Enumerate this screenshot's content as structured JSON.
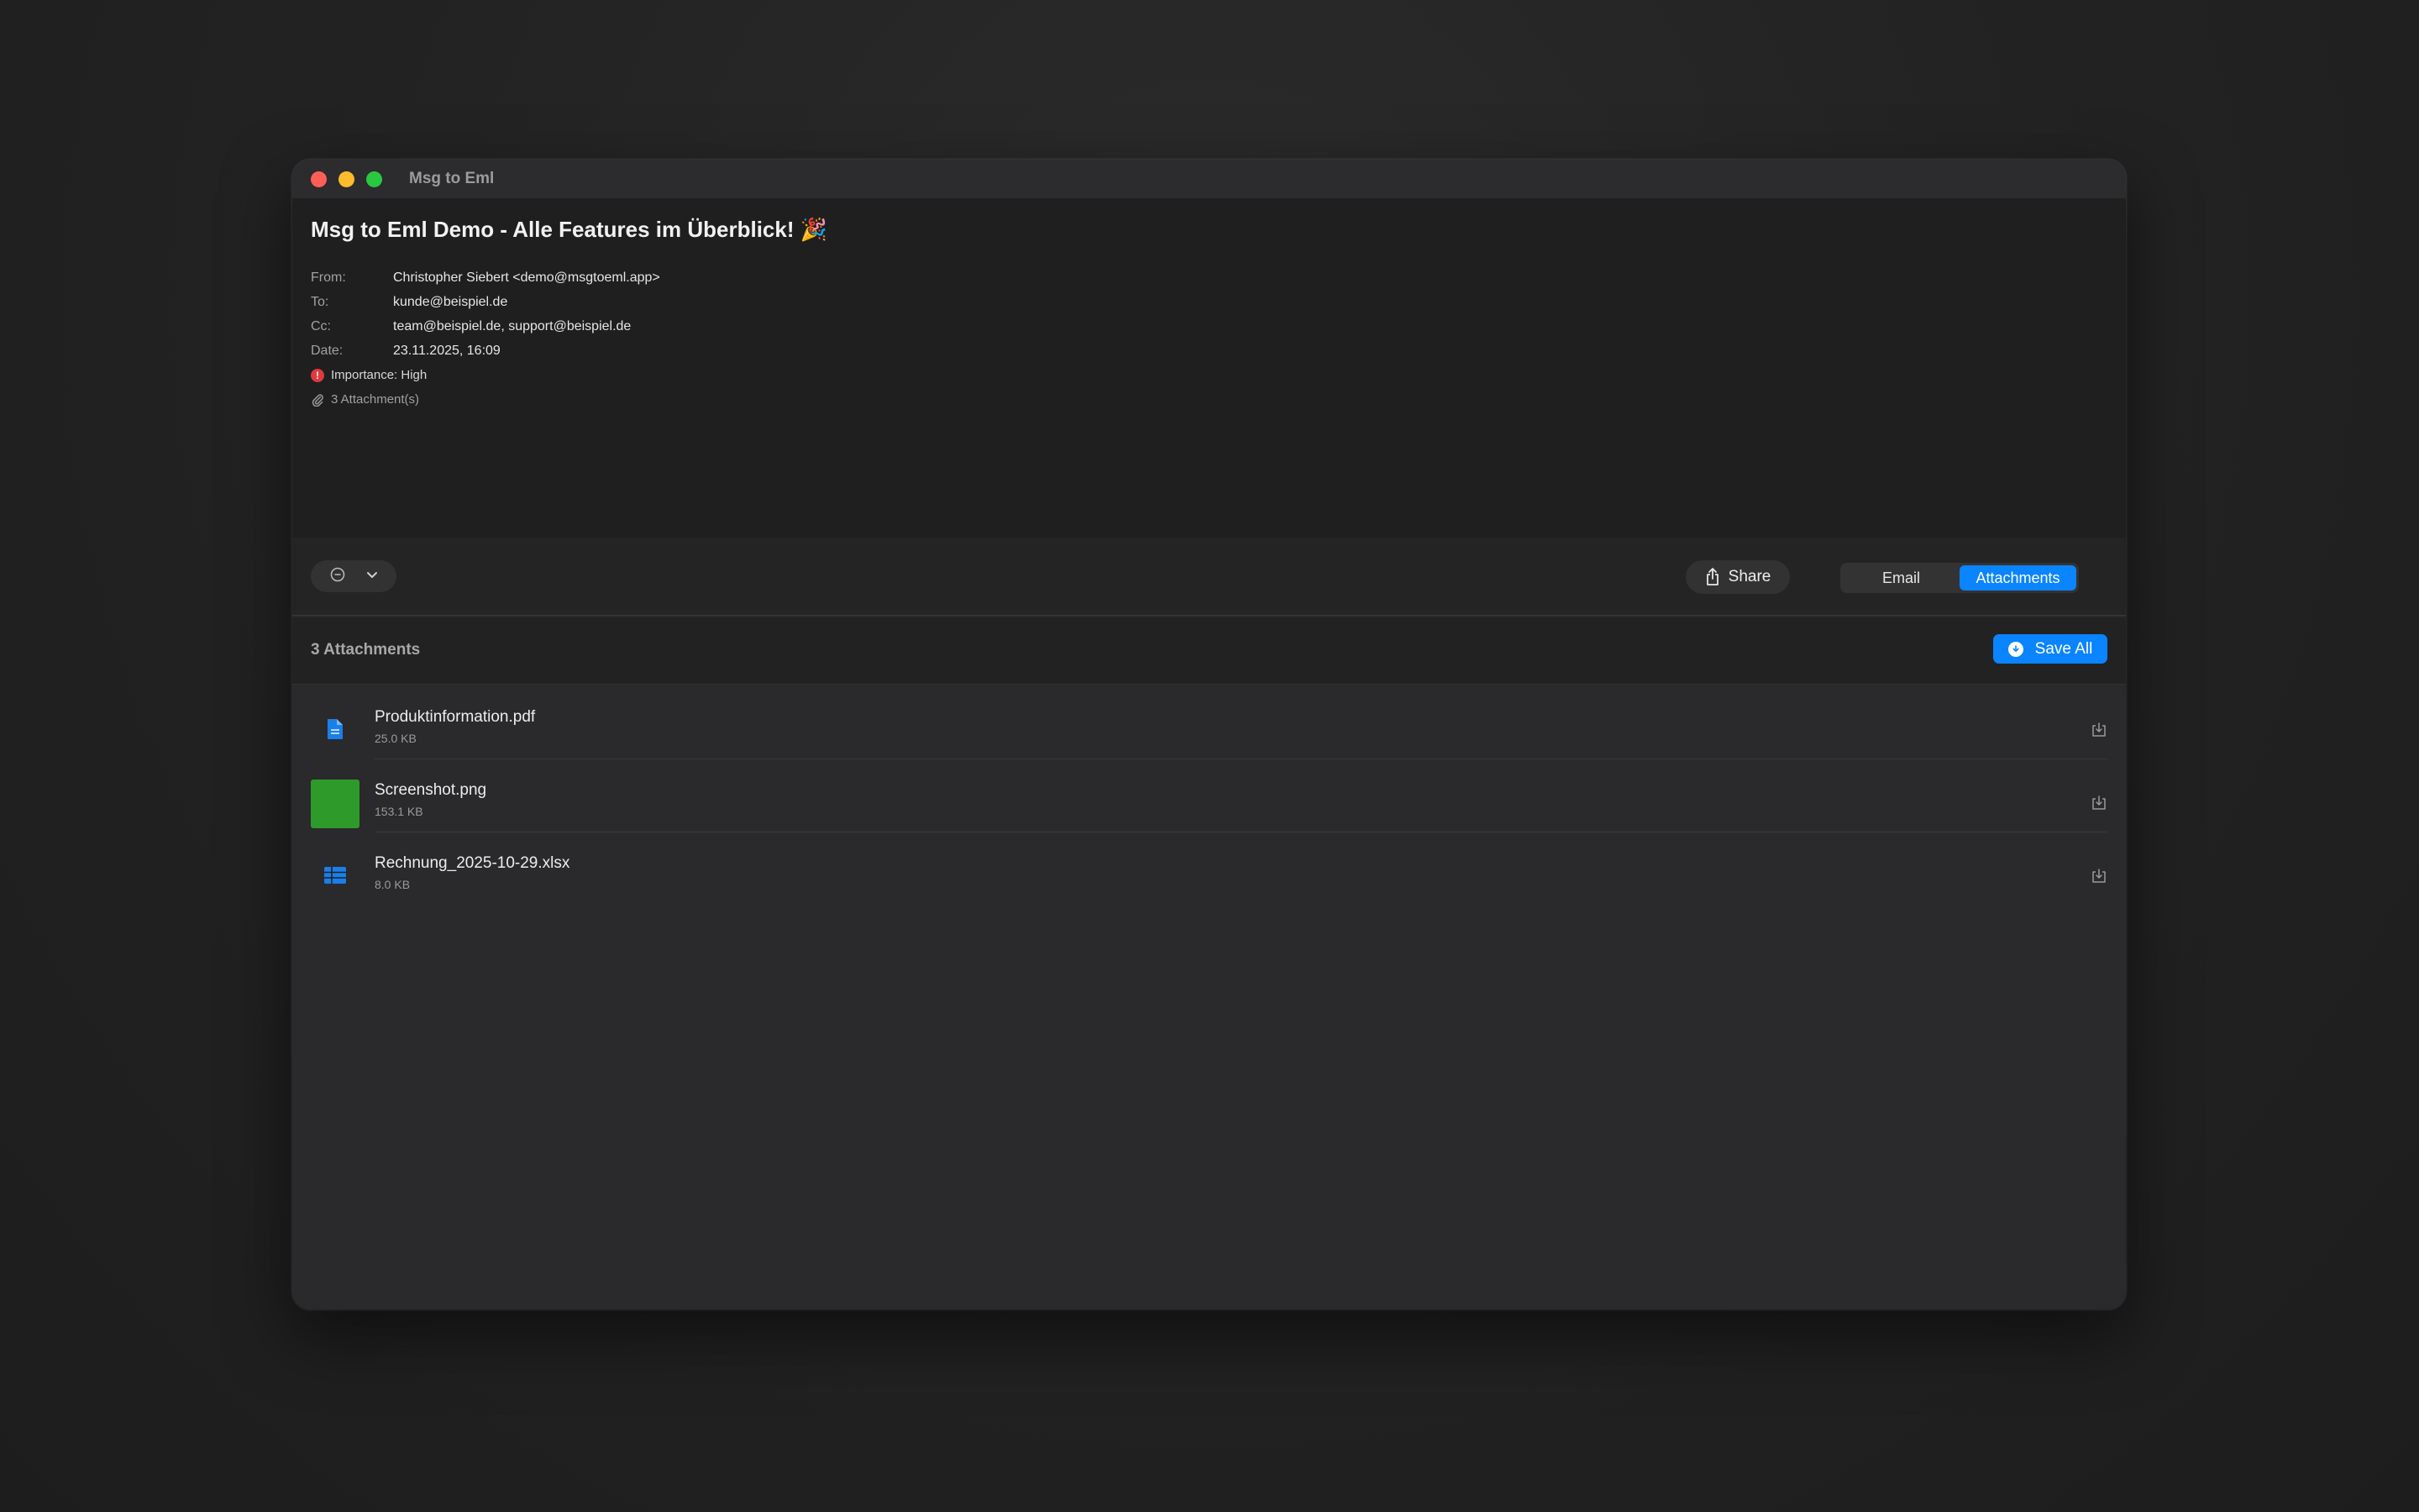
{
  "window": {
    "title": "Msg to Eml"
  },
  "email": {
    "subject": "Msg to Eml Demo - Alle Features im Überblick! 🎉",
    "fields": [
      {
        "label": "From:",
        "value": "Christopher Siebert <demo@msgtoeml.app>"
      },
      {
        "label": "To:",
        "value": "kunde@beispiel.de"
      },
      {
        "label": "Cc:",
        "value": "team@beispiel.de, support@beispiel.de"
      },
      {
        "label": "Date:",
        "value": "23.11.2025, 16:09"
      }
    ],
    "importance": "Importance: High",
    "attachment_count_text": "3 Attachment(s)"
  },
  "toolbar": {
    "share_label": "Share",
    "tabs": [
      {
        "label": "Email",
        "active": false
      },
      {
        "label": "Attachments",
        "active": true
      }
    ]
  },
  "attachments": {
    "title": "3 Attachments",
    "save_all_label": "Save All",
    "items": [
      {
        "name": "Produktinformation.pdf",
        "size": "25.0 KB",
        "icon": "document-icon"
      },
      {
        "name": "Screenshot.png",
        "size": "153.1 KB",
        "icon": "image-thumbnail"
      },
      {
        "name": "Rechnung_2025-10-29.xlsx",
        "size": "8.0 KB",
        "icon": "spreadsheet-icon"
      }
    ]
  },
  "colors": {
    "accent": "#0a84ff",
    "importance": "#e0393e",
    "thumbnail": "#2e9a2a"
  }
}
